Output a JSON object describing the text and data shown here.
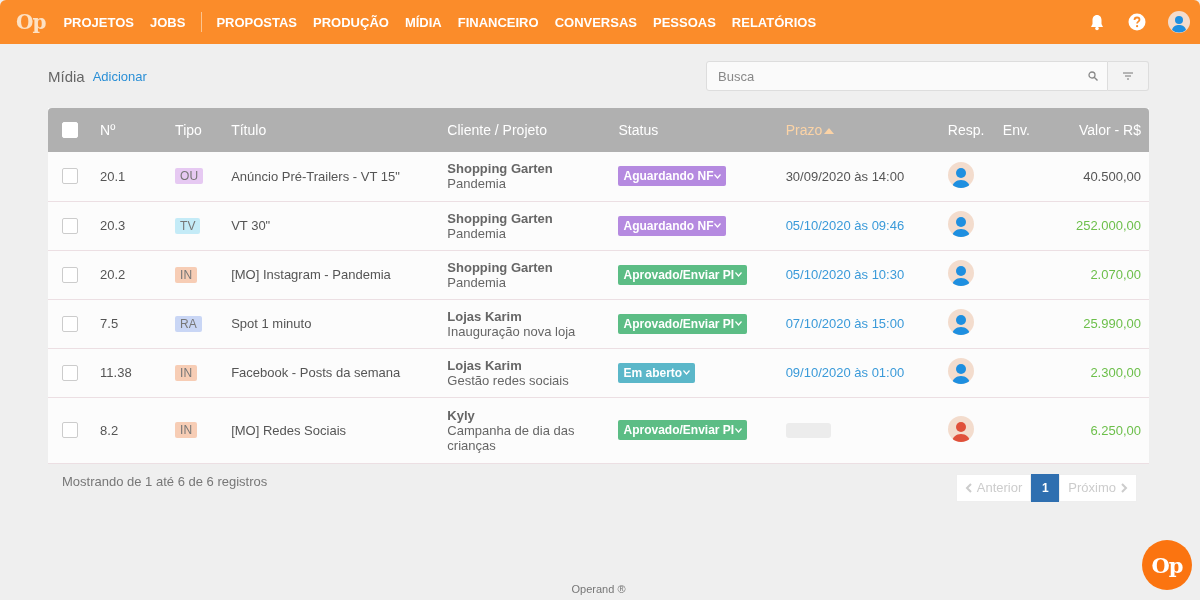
{
  "nav": {
    "logo": "Op",
    "groups": [
      {
        "items": [
          {
            "label": "PROJETOS"
          },
          {
            "label": "JOBS"
          }
        ]
      },
      {
        "items": [
          {
            "label": "PROPOSTAS"
          },
          {
            "label": "PRODUÇÃO"
          },
          {
            "label": "MÍDIA"
          },
          {
            "label": "FINANCEIRO"
          },
          {
            "label": "CONVERSAS"
          },
          {
            "label": "PESSOAS"
          },
          {
            "label": "RELATÓRIOS"
          }
        ]
      }
    ]
  },
  "page": {
    "title": "Mídia",
    "add_link": "Adicionar"
  },
  "search": {
    "placeholder": "Busca"
  },
  "table": {
    "select_all": {
      "checked": false
    },
    "columns": [
      {
        "label": "Nº",
        "sorted": false
      },
      {
        "label": "Tipo",
        "sorted": false
      },
      {
        "label": "Título",
        "sorted": false
      },
      {
        "label": "Cliente / Projeto",
        "sorted": false
      },
      {
        "label": "Status",
        "sorted": false
      },
      {
        "label": "Prazo",
        "sorted": true
      },
      {
        "label": "Resp.",
        "sorted": false
      },
      {
        "label": "Env.",
        "sorted": false
      },
      {
        "label": "Valor - R$",
        "sorted": false
      }
    ],
    "rows": [
      {
        "checked": false,
        "number": "20.1",
        "type": {
          "code": "OU",
          "color": "#e6c9f2"
        },
        "title": "Anúncio Pré-Trailers - VT 15\"",
        "client": "Shopping Garten",
        "project": "Pandemia",
        "status": {
          "label": "Aguardando NF",
          "color": "#b58ae0"
        },
        "deadline": "30/09/2020 às 14:00",
        "deadline_highlighted": false,
        "avatar": {
          "color": "#1e8fe0"
        },
        "value": "40.500,00",
        "value_highlighted": false
      },
      {
        "checked": false,
        "number": "20.3",
        "type": {
          "code": "TV",
          "color": "#c4ebf7"
        },
        "title": "VT 30\"",
        "client": "Shopping Garten",
        "project": "Pandemia",
        "status": {
          "label": "Aguardando NF",
          "color": "#b58ae0"
        },
        "deadline": "05/10/2020 às 09:46",
        "deadline_highlighted": true,
        "avatar": {
          "color": "#1e8fe0"
        },
        "value": "252.000,00",
        "value_highlighted": true
      },
      {
        "checked": false,
        "number": "20.2",
        "type": {
          "code": "IN",
          "color": "#f7cdb5"
        },
        "title": "[MO] Instagram - Pandemia",
        "client": "Shopping Garten",
        "project": "Pandemia",
        "status": {
          "label": "Aprovado/Enviar PI",
          "color": "#5cbd85"
        },
        "deadline": "05/10/2020 às 10:30",
        "deadline_highlighted": true,
        "avatar": {
          "color": "#1e8fe0"
        },
        "value": "2.070,00",
        "value_highlighted": true
      },
      {
        "checked": false,
        "number": "7.5",
        "type": {
          "code": "RA",
          "color": "#c9d6f5"
        },
        "title": "Spot 1 minuto",
        "client": "Lojas Karim",
        "project": "Inauguração nova loja",
        "status": {
          "label": "Aprovado/Enviar PI",
          "color": "#5cbd85"
        },
        "deadline": "07/10/2020 às 15:00",
        "deadline_highlighted": true,
        "avatar": {
          "color": "#1e8fe0"
        },
        "value": "25.990,00",
        "value_highlighted": true
      },
      {
        "checked": false,
        "number": "11.38",
        "type": {
          "code": "IN",
          "color": "#f7cdb5"
        },
        "title": "Facebook - Posts da semana",
        "client": "Lojas Karim",
        "project": "Gestão redes sociais",
        "status": {
          "label": "Em aberto",
          "color": "#5bb7c9"
        },
        "deadline": "09/10/2020 às 01:00",
        "deadline_highlighted": true,
        "avatar": {
          "color": "#1e8fe0"
        },
        "value": "2.300,00",
        "value_highlighted": true
      },
      {
        "checked": false,
        "number": "8.2",
        "type": {
          "code": "IN",
          "color": "#f7cdb5"
        },
        "title": "[MO] Redes Sociais",
        "client": "Kyly",
        "project": "Campanha de dia das crianças",
        "status": {
          "label": "Aprovado/Enviar PI",
          "color": "#5cbd85"
        },
        "avatar": {
          "color": "#e0503a"
        },
        "value": "6.250,00",
        "value_highlighted": true
      }
    ]
  },
  "summary": "Mostrando de 1 até 6 de 6 registros",
  "pagination": {
    "previous": {
      "label": "Anterior",
      "disabled": true
    },
    "pages": [
      {
        "label": "1",
        "selected": true
      }
    ],
    "next": {
      "label": "Próximo",
      "disabled": true
    }
  },
  "footer": "Operand ®",
  "fab": {
    "label": "Op"
  }
}
